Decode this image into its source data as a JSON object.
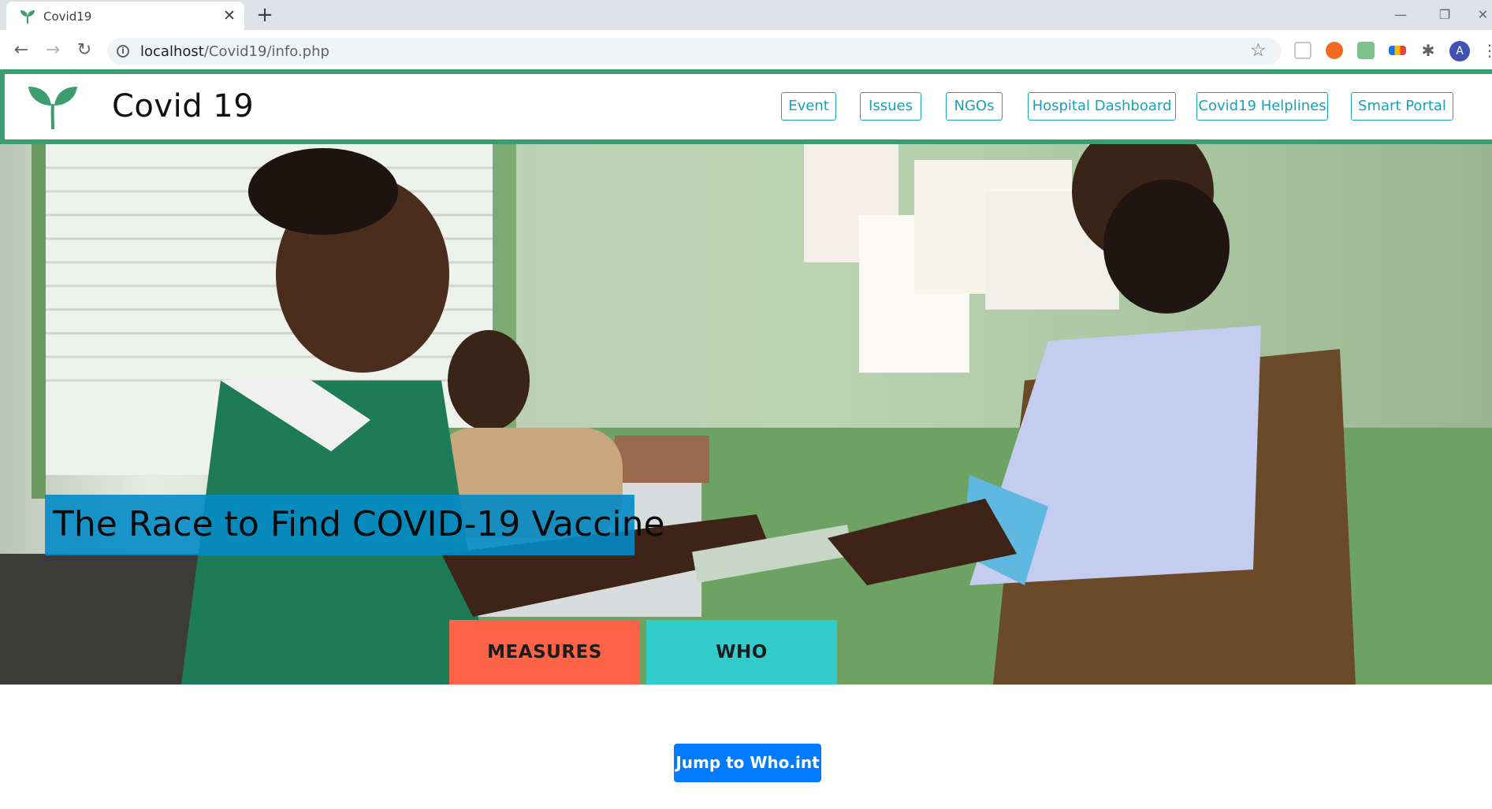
{
  "browser": {
    "tab_title": "Covid19",
    "tab_close": "✕",
    "new_tab": "+",
    "url_host": "localhost",
    "url_path": "/Covid19/info.php",
    "avatar_letter": "A",
    "icons": [
      "back-icon",
      "forward-icon",
      "reload-icon",
      "info-icon",
      "star-icon",
      "extensions-icon",
      "menu-icon"
    ]
  },
  "header": {
    "brand": "Covid 19",
    "nav": [
      "Event",
      "Issues",
      "NGOs",
      "Hospital Dashboard",
      "Covid19 Helplines",
      "Smart Portal"
    ]
  },
  "hero": {
    "caption": "The Race to Find COVID-19 Vaccine",
    "buttons": [
      "MEASURES",
      "WHO"
    ]
  },
  "main": {
    "jump_button": "Jump to Who.int"
  },
  "colors": {
    "header_border": "#3e9d6f",
    "nav_accent": "#17a2b8",
    "caption_bg": "#038bc6",
    "measures_bg": "#ff6347",
    "who_bg": "#33cccc",
    "jump_bg": "#007bff"
  }
}
